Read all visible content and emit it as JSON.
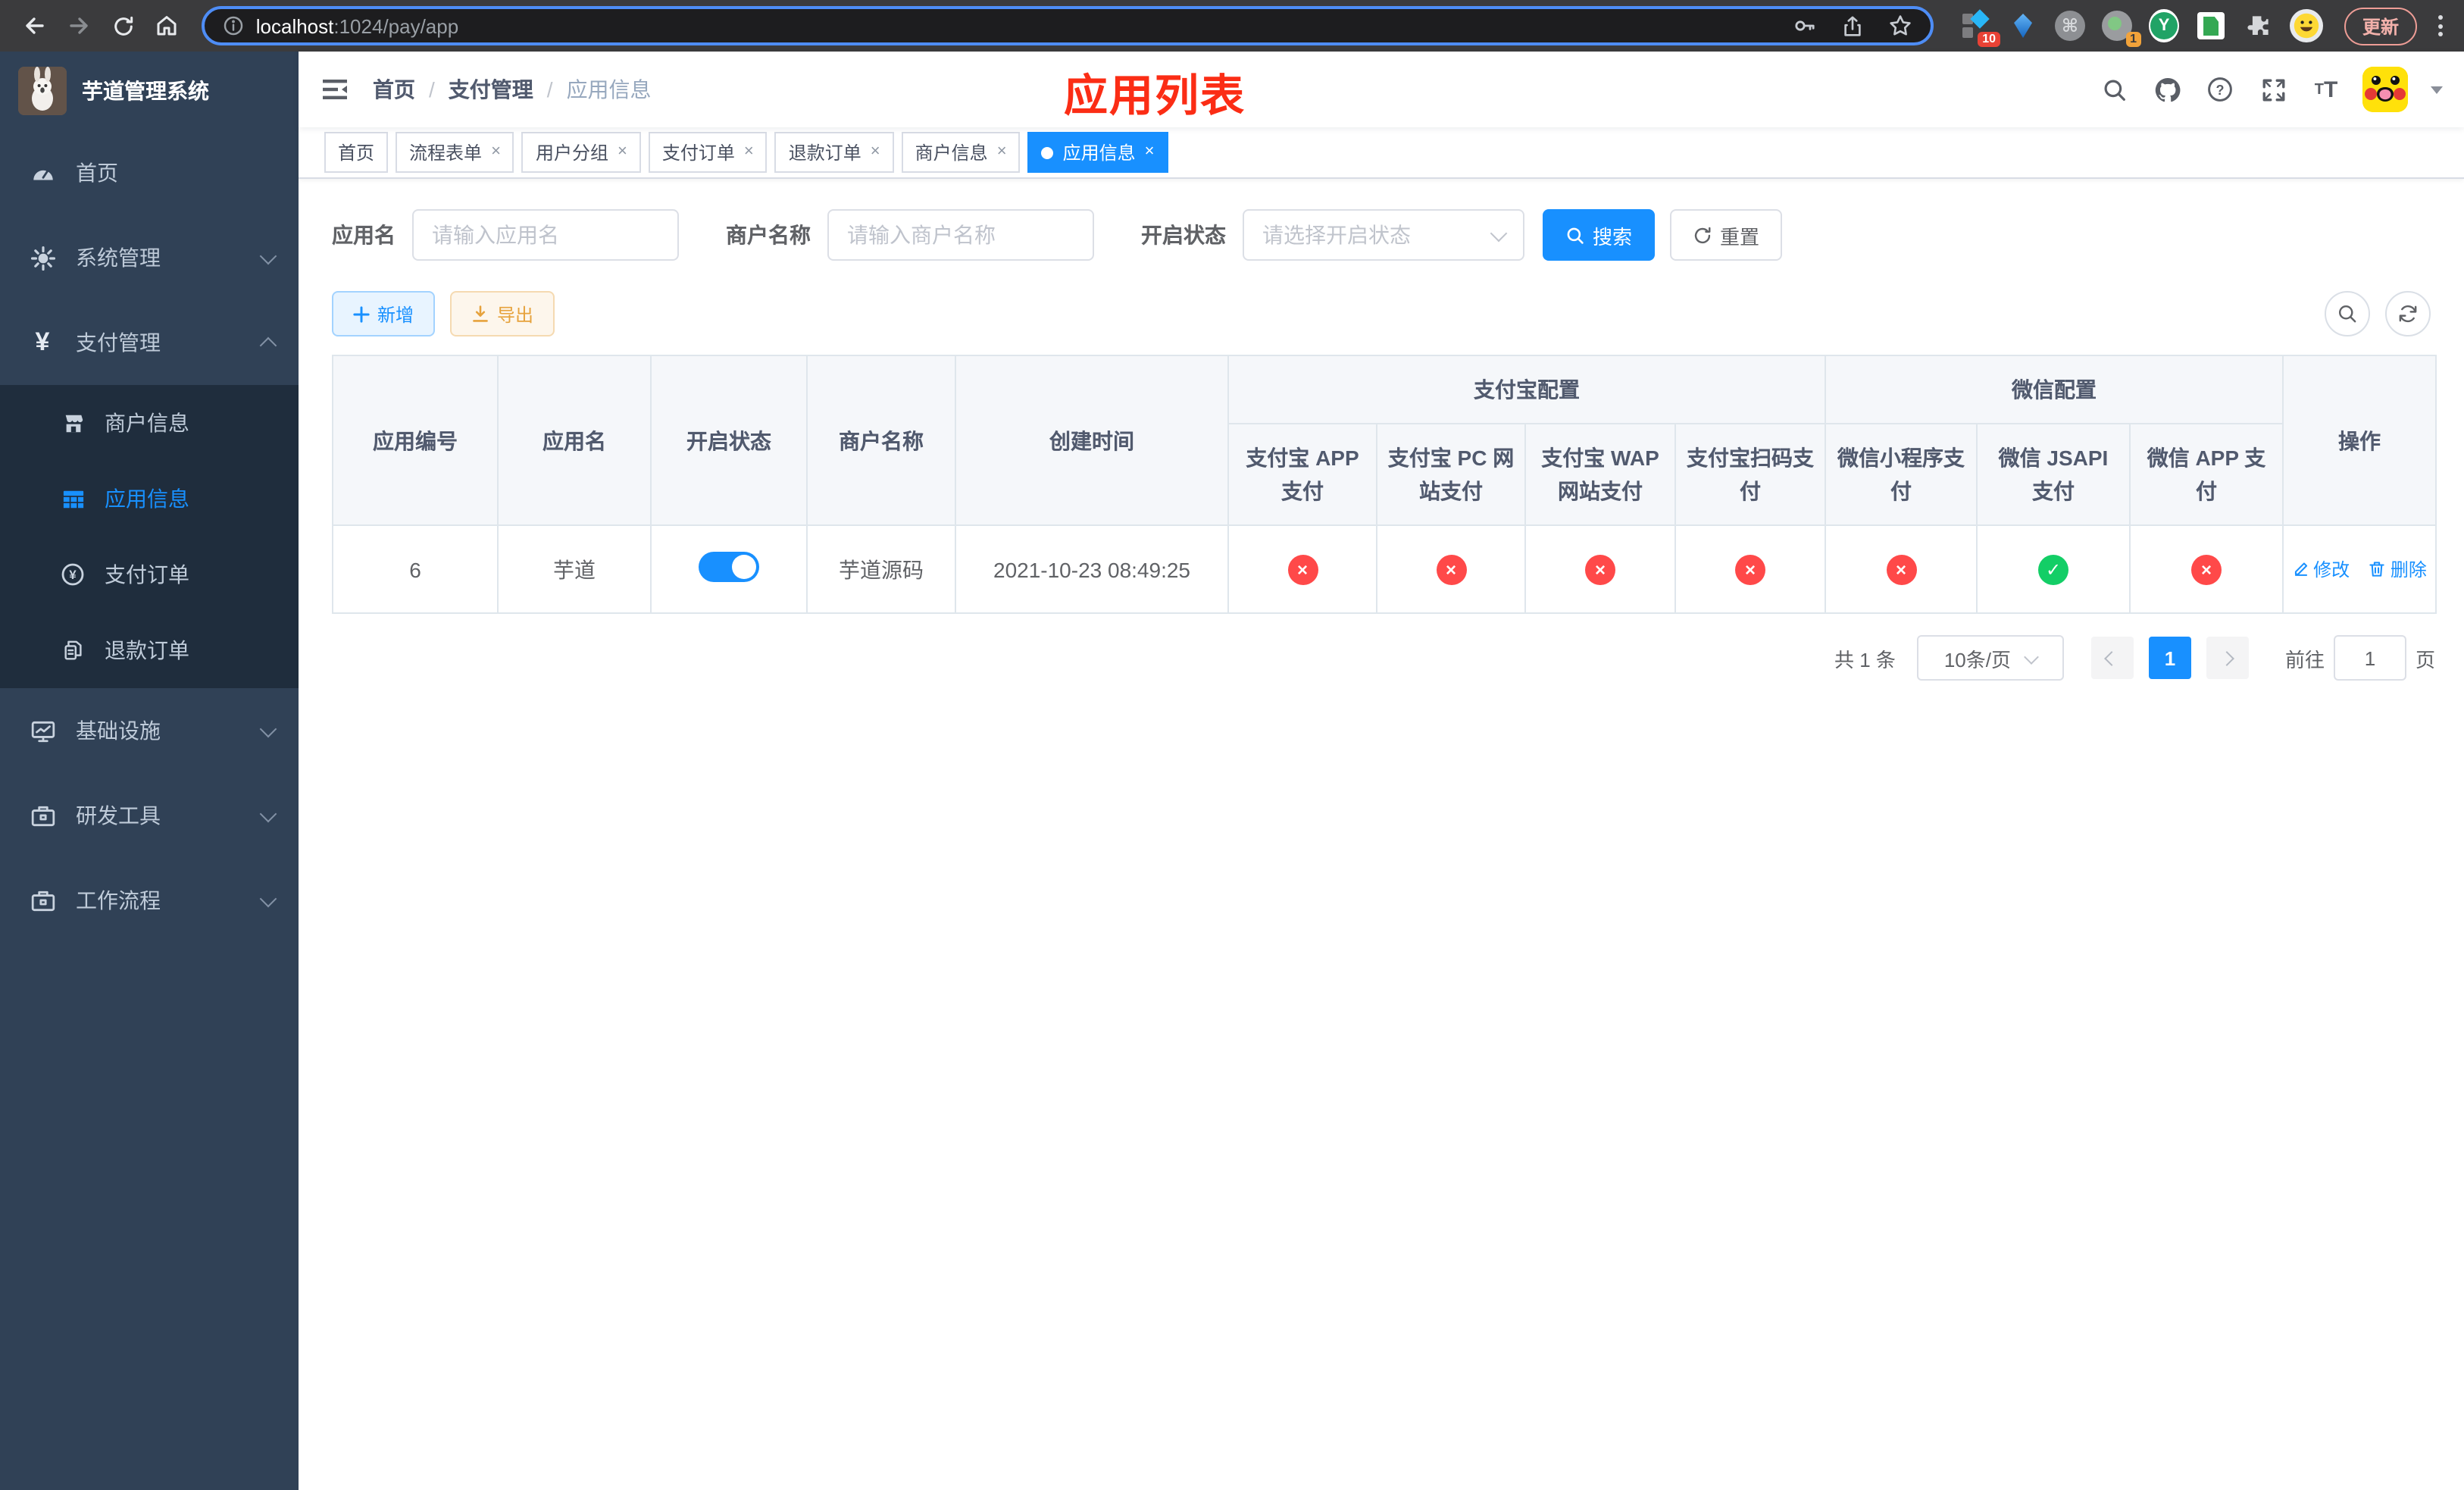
{
  "browser": {
    "url_host": "localhost",
    "url_path": ":1024/pay/app",
    "update_label": "更新",
    "devtools_badge": "10",
    "recorder_badge": "1",
    "y_ext_label": "Y"
  },
  "sidebar": {
    "app_title": "芋道管理系统",
    "items": [
      {
        "label": "首页",
        "icon": "dashboard-icon"
      },
      {
        "label": "系统管理",
        "icon": "gear-icon",
        "chevron": "down"
      },
      {
        "label": "支付管理",
        "icon": "yen-icon",
        "chevron": "up"
      },
      {
        "label": "基础设施",
        "icon": "monitor-icon",
        "chevron": "down"
      },
      {
        "label": "研发工具",
        "icon": "toolbox-icon",
        "chevron": "down"
      },
      {
        "label": "工作流程",
        "icon": "briefcase-icon",
        "chevron": "down"
      }
    ],
    "payment_submenu": [
      {
        "label": "商户信息",
        "icon": "shop-icon",
        "active": false
      },
      {
        "label": "应用信息",
        "icon": "grid-icon",
        "active": true
      },
      {
        "label": "支付订单",
        "icon": "yen-circle-icon",
        "active": false
      },
      {
        "label": "退款订单",
        "icon": "document-icon",
        "active": false
      }
    ]
  },
  "navbar": {
    "breadcrumb": [
      "首页",
      "支付管理",
      "应用信息"
    ],
    "annotation_title": "应用列表"
  },
  "tags": {
    "items": [
      {
        "label": "首页",
        "closable": false,
        "active": false
      },
      {
        "label": "流程表单",
        "closable": true,
        "active": false
      },
      {
        "label": "用户分组",
        "closable": true,
        "active": false
      },
      {
        "label": "支付订单",
        "closable": true,
        "active": false
      },
      {
        "label": "退款订单",
        "closable": true,
        "active": false
      },
      {
        "label": "商户信息",
        "closable": true,
        "active": false
      },
      {
        "label": "应用信息",
        "closable": true,
        "active": true
      }
    ]
  },
  "search": {
    "app_name_label": "应用名",
    "app_name_placeholder": "请输入应用名",
    "merchant_label": "商户名称",
    "merchant_placeholder": "请输入商户名称",
    "status_label": "开启状态",
    "status_placeholder": "请选择开启状态",
    "search_button": "搜索",
    "reset_button": "重置"
  },
  "toolbar": {
    "add_button": "新增",
    "export_button": "导出"
  },
  "table": {
    "headers": {
      "app_id": "应用编号",
      "app_name": "应用名",
      "enabled": "开启状态",
      "merchant_name": "商户名称",
      "create_time": "创建时间",
      "alipay_group": "支付宝配置",
      "wechat_group": "微信配置",
      "channels": [
        "支付宝 APP 支付",
        "支付宝 PC 网站支付",
        "支付宝 WAP 网站支付",
        "支付宝扫码支付",
        "微信小程序支付",
        "微信 JSAPI 支付",
        "微信 APP 支付"
      ],
      "actions": "操作"
    },
    "row": {
      "id": "6",
      "name": "芋道",
      "enabled": true,
      "merchant": "芋道源码",
      "created_at": "2021-10-23 08:49:25",
      "channels": [
        false,
        false,
        false,
        false,
        false,
        true,
        false
      ],
      "edit_label": "修改",
      "delete_label": "删除"
    }
  },
  "pagination": {
    "total": "共 1 条",
    "page_size": "10条/页",
    "current_page": "1",
    "goto_label": "前往",
    "goto_value": "1",
    "page_unit": "页"
  },
  "colors": {
    "primary": "#1890ff",
    "danger": "#ff4949",
    "success": "#13ce66",
    "annotation_red": "#fb2d15",
    "sidebar_bg": "#304156",
    "submenu_bg": "#1f2d3d"
  }
}
